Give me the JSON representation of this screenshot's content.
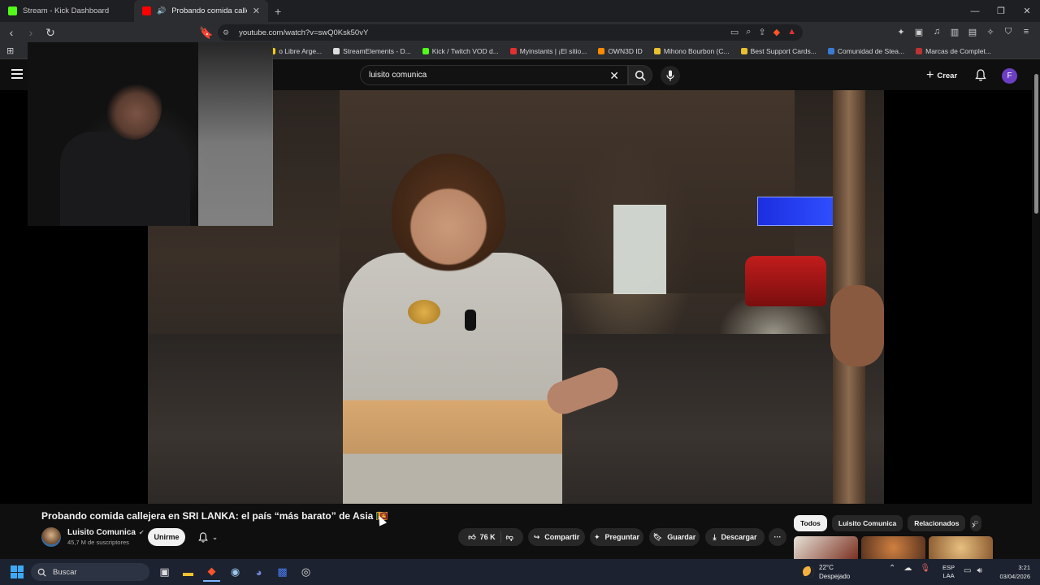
{
  "browser": {
    "tabs": [
      {
        "title": "Stream - Kick Dashboard",
        "fav_color": "#53fc18",
        "active": false
      },
      {
        "title": "Probando comida callejera en",
        "fav_color": "#ff0000",
        "active": true
      }
    ],
    "new_tab": "+",
    "address": "youtube.com/watch?v=swQ0Ksk50vY",
    "bookmarks": [
      {
        "label": "o Libre Arge...",
        "fav_color": "#ffd000"
      },
      {
        "label": "StreamElements - D...",
        "fav_color": "#dddddd"
      },
      {
        "label": "Kick / Twitch VOD d...",
        "fav_color": "#53fc18"
      },
      {
        "label": "Myinstants | ¡El sitio...",
        "fav_color": "#e23030"
      },
      {
        "label": "OWN3D ID",
        "fav_color": "#ff8a00"
      },
      {
        "label": "Mihono Bourbon (C...",
        "fav_color": "#e8c030"
      },
      {
        "label": "Best Support Cards...",
        "fav_color": "#e8c030"
      },
      {
        "label": "Comunidad de Stea...",
        "fav_color": "#3a7bd5"
      },
      {
        "label": "Marcas de Complet...",
        "fav_color": "#b33"
      }
    ]
  },
  "youtube": {
    "search_value": "luisito comunica",
    "create_label": "Crear",
    "avatar_letter": "F",
    "video_title": "Probando comida callejera en SRI LANKA: el país “más barato” de Asia 🇱🇰",
    "channel_name": "Luisito Comunica",
    "channel_subs": "45,7 M de suscriptores",
    "join_label": "Unirme",
    "like_count": "76 K",
    "share_label": "Compartir",
    "ask_label": "Preguntar",
    "save_label": "Guardar",
    "download_label": "Descargar",
    "more_label": "···",
    "chips": [
      "Todos",
      "Relacionados",
      "Luisito Comunica",
      "P"
    ],
    "chip_next": "›"
  },
  "taskbar": {
    "search_label": "Buscar",
    "weather_temp": "22°C",
    "weather_desc": "Despejado",
    "lang_top": "ESP",
    "lang_bottom": "LAA",
    "time": "3:21",
    "date": "03/04/2026"
  },
  "colors": {
    "accent": "#3ea6ff",
    "yt_bg": "#0f0f0f",
    "avatar": "#6a3fc2"
  }
}
